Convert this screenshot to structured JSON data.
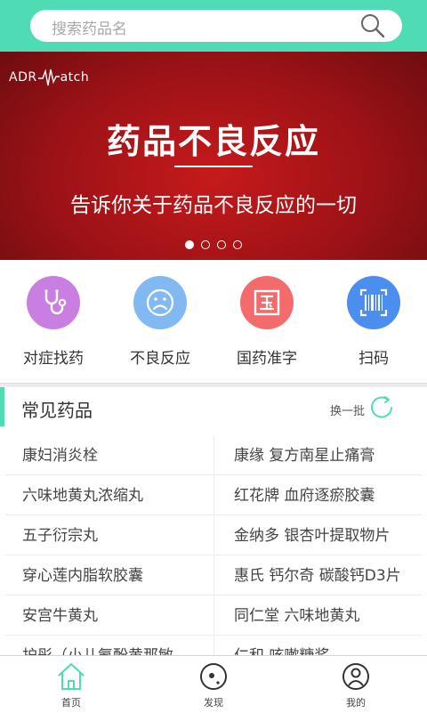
{
  "search": {
    "placeholder": "搜索药品名"
  },
  "banner": {
    "logo_left": "ADR",
    "logo_right": "atch",
    "title": "药品不良反应",
    "subtitle": "告诉你关于药品不良反应的一切",
    "slides": 4,
    "active_slide": 1
  },
  "quick_actions": [
    {
      "label": "对症找药",
      "icon": "stethoscope-icon",
      "color": "#c97fe2"
    },
    {
      "label": "不良反应",
      "icon": "sad-face-icon",
      "color": "#82b9f2"
    },
    {
      "label": "国药准字",
      "icon": "guo-character-icon",
      "color": "#f36b6b"
    },
    {
      "label": "扫码",
      "icon": "barcode-scan-icon",
      "color": "#4c8eef"
    }
  ],
  "common_drugs": {
    "title": "常见药品",
    "refresh_label": "换一批",
    "rows": [
      [
        "康妇消炎栓",
        "康缘 复方南星止痛膏"
      ],
      [
        "六味地黄丸浓缩丸",
        "红花牌 血府逐瘀胶囊"
      ],
      [
        "五子衍宗丸",
        "金纳多 银杏叶提取物片"
      ],
      [
        "穿心莲内脂软胶囊",
        "惠氏 钙尔奇 碳酸钙D3片"
      ],
      [
        "安宫牛黄丸",
        "同仁堂 六味地黄丸"
      ],
      [
        "护彤（小儿氨酚黄那敏",
        "仁和 咳嗽糖浆"
      ]
    ]
  },
  "colors": {
    "accent": "#4fdcb4",
    "banner": "#b3161a"
  },
  "tabbar": [
    {
      "label": "首页",
      "icon": "home-icon",
      "active": true
    },
    {
      "label": "发现",
      "icon": "discover-icon",
      "active": false
    },
    {
      "label": "我的",
      "icon": "profile-icon",
      "active": false
    }
  ]
}
